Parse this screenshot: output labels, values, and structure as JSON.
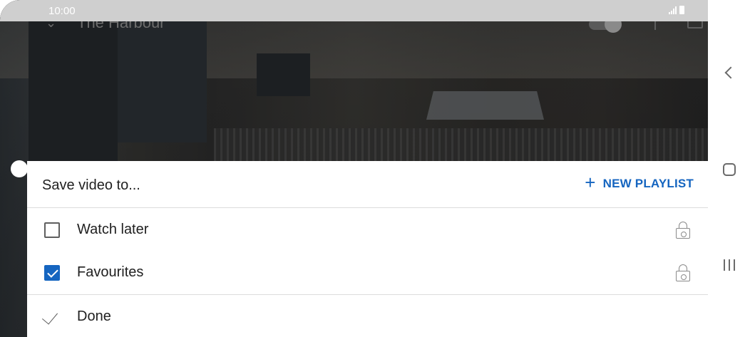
{
  "status_bar": {
    "time": "10:00"
  },
  "player": {
    "video_title": "The Harbour"
  },
  "sheet": {
    "title": "Save video to...",
    "new_playlist_label": "NEW PLAYLIST",
    "playlists": [
      {
        "label": "Watch later",
        "checked": false,
        "private": true
      },
      {
        "label": "Favourites",
        "checked": true,
        "private": true
      }
    ],
    "done_label": "Done"
  },
  "colors": {
    "accent": "#1565c0",
    "text": "#1f1f1f",
    "divider": "#dcdcdc"
  },
  "icons": {
    "back": "chevron-left-icon",
    "home": "home-icon",
    "recents": "recent-apps-icon",
    "lock": "lock-icon",
    "plus": "plus-icon",
    "check": "check-icon"
  }
}
